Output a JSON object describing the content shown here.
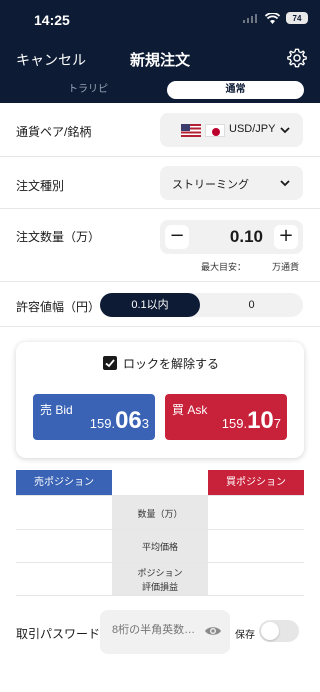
{
  "status_bar": {
    "time": "14:25",
    "battery": "74"
  },
  "nav": {
    "cancel": "キャンセル",
    "title": "新規注文"
  },
  "top_tabs": [
    "トラリピ",
    "通常"
  ],
  "currency_pair": {
    "label": "通貨ペア/銘柄",
    "value": "USD/JPY"
  },
  "order_type": {
    "label": "注文種別",
    "value": "ストリーミング"
  },
  "quantity": {
    "label": "注文数量（万）",
    "value": "0.10",
    "minus": "−",
    "plus": "+",
    "hint_label": "最大目安：",
    "hint_unit": "万通貨"
  },
  "tolerance": {
    "label": "許容値幅（円）",
    "option_left": "0.1以内",
    "option_right": "0"
  },
  "lock": {
    "label": "ロックを解除する",
    "checked": true
  },
  "bid": {
    "label": "売 Bid",
    "price_small": "159.",
    "price_big": "06",
    "price_last": "3",
    "color": "#3a63b6"
  },
  "ask": {
    "label": "買 Ask",
    "price_small": "159.",
    "price_big": "10",
    "price_last": "7",
    "color": "#c8213a"
  },
  "positions": {
    "sell_header": "売ポジション",
    "buy_header": "買ポジション",
    "rows": [
      "数量（万）",
      "平均価格",
      "ポジション",
      "評価損益"
    ]
  },
  "password": {
    "label": "取引パスワード",
    "placeholder": "8桁の半角英数…",
    "save_label": "保存"
  },
  "colors": {
    "navy": "#0d1b34",
    "sell": "#3a63b6",
    "buy": "#c8213a"
  }
}
